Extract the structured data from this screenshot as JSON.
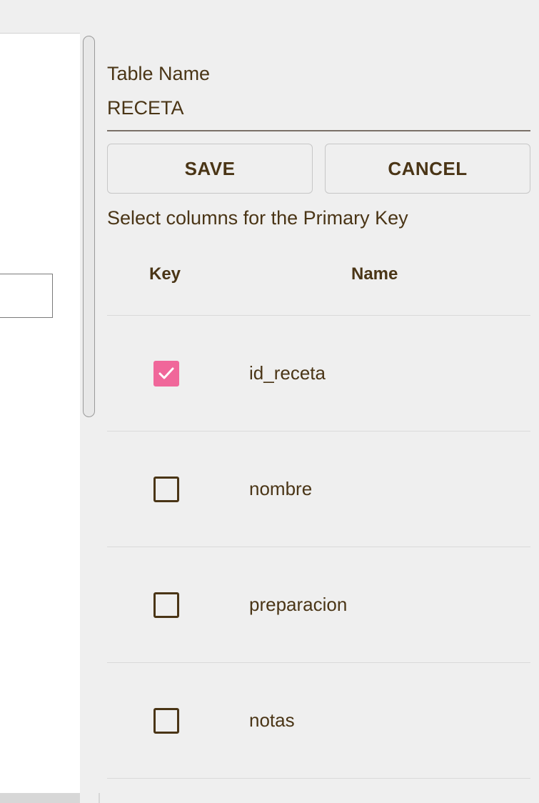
{
  "table_name": {
    "label": "Table Name",
    "value": "RECETA"
  },
  "actions": {
    "save_label": "SAVE",
    "cancel_label": "CANCEL"
  },
  "primary_key": {
    "title": "Select columns for the Primary Key",
    "headers": {
      "key": "Key",
      "name": "Name"
    },
    "columns": [
      {
        "name": "id_receta",
        "is_key": true
      },
      {
        "name": "nombre",
        "is_key": false
      },
      {
        "name": "preparacion",
        "is_key": false
      },
      {
        "name": "notas",
        "is_key": false
      }
    ]
  },
  "colors": {
    "accent": "#f0679a",
    "text": "#4a3516",
    "background": "#efefef"
  }
}
